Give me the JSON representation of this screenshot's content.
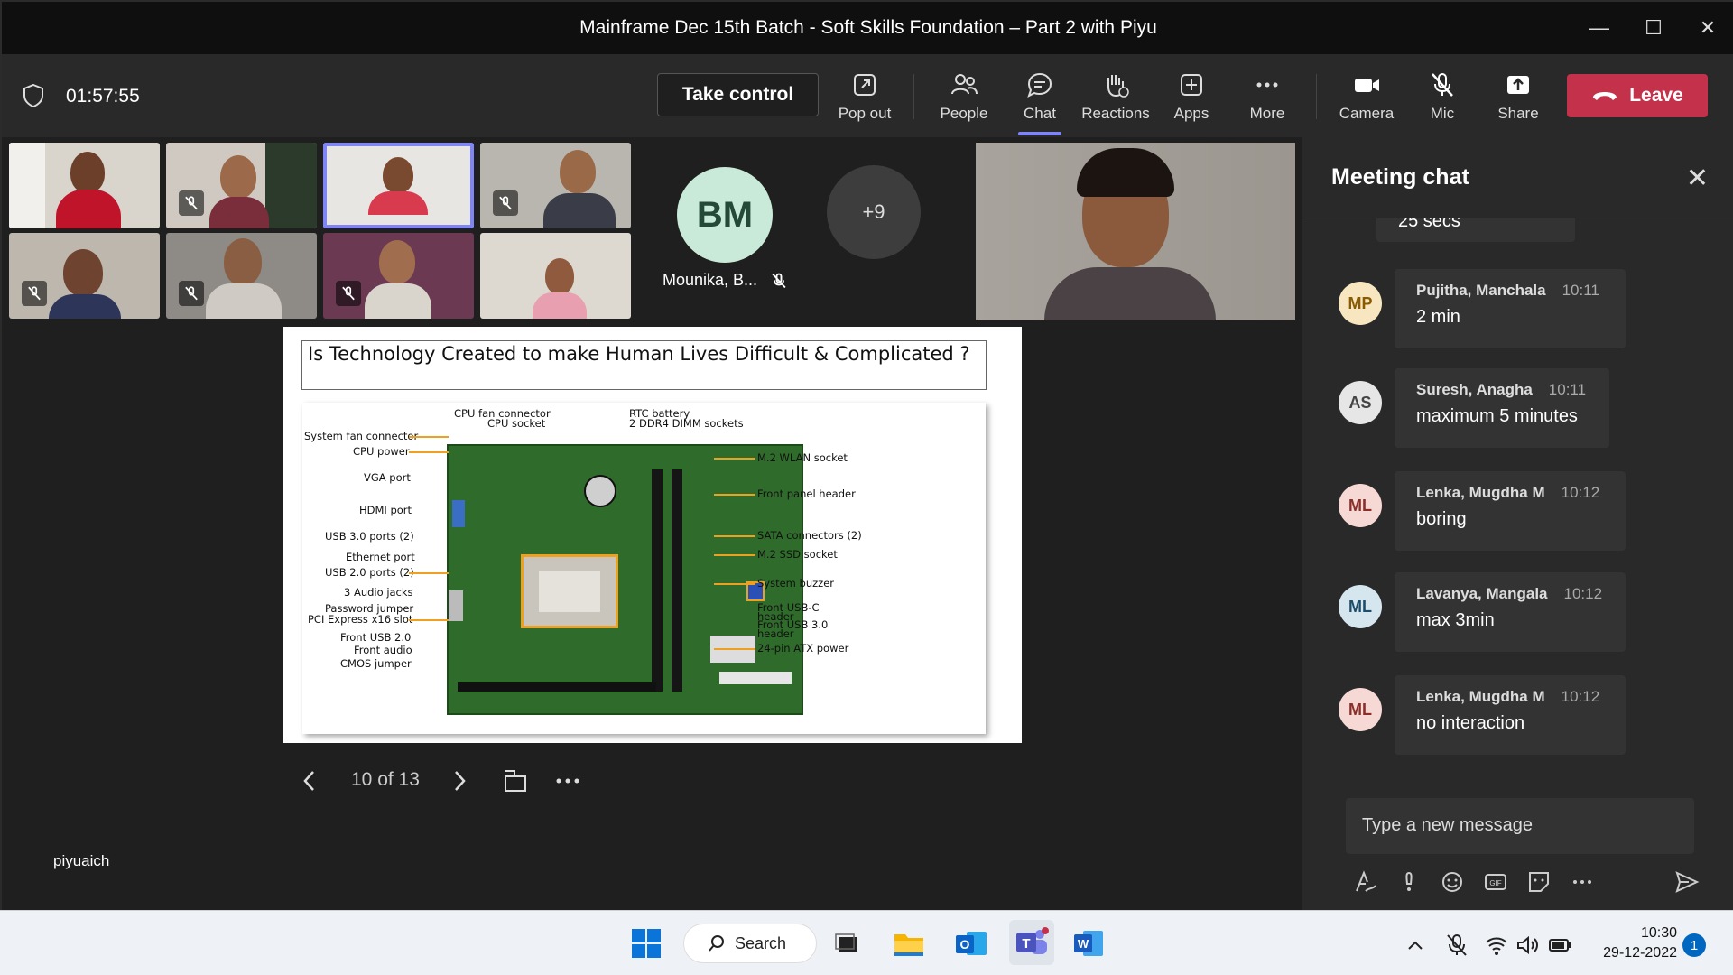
{
  "window": {
    "title": "Mainframe Dec 15th Batch - Soft Skills Foundation – Part 2 with Piyu"
  },
  "toolbar": {
    "timer": "01:57:55",
    "take_control": "Take control",
    "pop_out": "Pop out",
    "people": "People",
    "chat": "Chat",
    "reactions": "Reactions",
    "apps": "Apps",
    "more": "More",
    "camera": "Camera",
    "mic": "Mic",
    "share": "Share",
    "leave": "Leave",
    "active_tab": "Chat"
  },
  "participants": {
    "avatar_initials": "BM",
    "avatar_name": "Mounika, B...",
    "overflow_count": "+9",
    "self_name": "piyuaich"
  },
  "slide": {
    "question": "Is Technology Created to make Human Lives Difficult & Complicated ?",
    "labels_left": [
      "System fan connector",
      "CPU power",
      "VGA port",
      "HDMI port",
      "USB 3.0 ports (2)",
      "Ethernet port",
      "USB 2.0 ports (2)",
      "3 Audio jacks",
      "Password jumper",
      "PCI Express x16 slot",
      "Front USB 2.0",
      "Front audio",
      "CMOS jumper"
    ],
    "labels_top": [
      "CPU fan connector",
      "CPU socket",
      "RTC battery",
      "2 DDR4 DIMM sockets"
    ],
    "labels_right": [
      "M.2 WLAN socket",
      "Front panel header",
      "SATA connectors (2)",
      "M.2 SSD socket",
      "System buzzer",
      "Front USB-C header",
      "Front USB 3.0 header",
      "24-pin ATX power"
    ]
  },
  "presentation": {
    "page_indicator": "10 of 13"
  },
  "chat": {
    "title": "Meeting chat",
    "partial_message": "25 secs",
    "messages": [
      {
        "initials": "MP",
        "name": "Pujitha, Manchala",
        "time": "10:11",
        "text": "2 min",
        "avatar_bg": "#f8e6c0",
        "avatar_fg": "#8a5a00"
      },
      {
        "initials": "AS",
        "name": "Suresh, Anagha",
        "time": "10:11",
        "text": "maximum 5 minutes",
        "avatar_bg": "#e6e6e6",
        "avatar_fg": "#444444"
      },
      {
        "initials": "ML",
        "name": "Lenka, Mugdha M",
        "time": "10:12",
        "text": "boring",
        "avatar_bg": "#f6d9d5",
        "avatar_fg": "#8a2f2a"
      },
      {
        "initials": "ML",
        "name": "Lavanya, Mangala",
        "time": "10:12",
        "text": "max 3min",
        "avatar_bg": "#d6e6ef",
        "avatar_fg": "#1e4d6b"
      },
      {
        "initials": "ML",
        "name": "Lenka, Mugdha M",
        "time": "10:12",
        "text": "no interaction",
        "avatar_bg": "#f6d9d5",
        "avatar_fg": "#8a2f2a"
      }
    ],
    "compose_placeholder": "Type a new message"
  },
  "taskbar": {
    "search": "Search",
    "time": "10:30",
    "date": "29-12-2022",
    "notifications": "1"
  },
  "colors": {
    "leave": "#c4314b",
    "accent": "#7f85f5",
    "toolbar_bg": "#292929"
  }
}
